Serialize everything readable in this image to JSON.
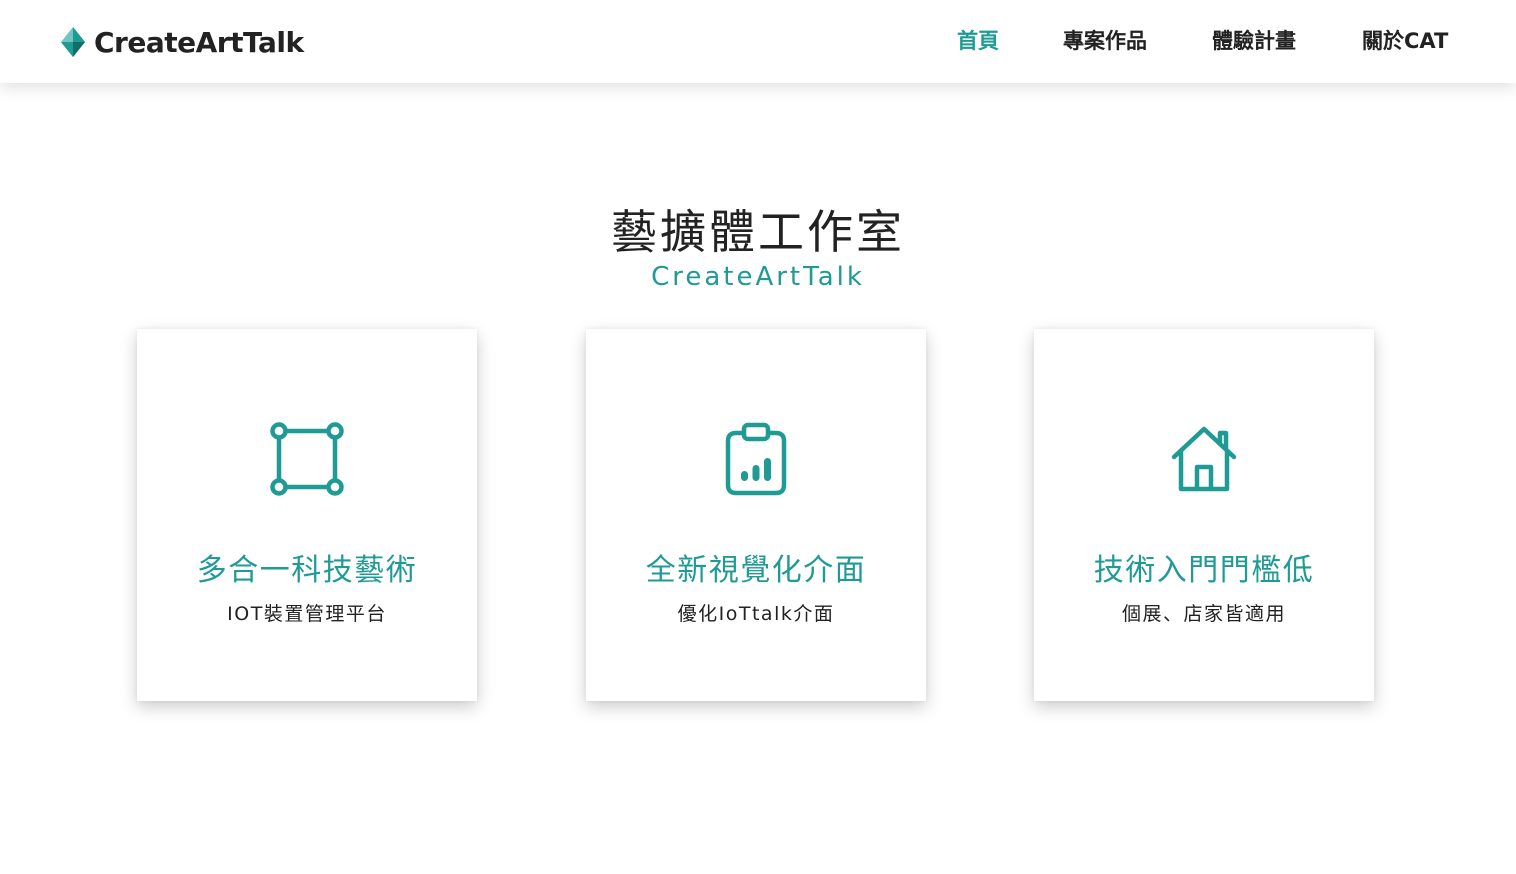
{
  "brand": {
    "name": "CreateArtTalk",
    "logo_icon": "diamond-logo-icon",
    "colors": {
      "accent": "#1f9a94",
      "accent_light": "#6fc6c0",
      "accent_dark": "#0f6f69"
    }
  },
  "nav": {
    "items": [
      {
        "label": "首頁",
        "active": true
      },
      {
        "label": "專案作品",
        "active": false
      },
      {
        "label": "體驗計畫",
        "active": false
      },
      {
        "label": "關於CAT",
        "active": false
      }
    ]
  },
  "hero": {
    "title": "藝擴體工作室",
    "subtitle": "CreateArtTalk"
  },
  "features": [
    {
      "icon": "bounding-box-icon",
      "title": "多合一科技藝術",
      "description": "IOT裝置管理平台"
    },
    {
      "icon": "clipboard-chart-icon",
      "title": "全新視覺化介面",
      "description": "優化IoTtalk介面"
    },
    {
      "icon": "house-icon",
      "title": "技術入門門檻低",
      "description": "個展、店家皆適用"
    }
  ]
}
